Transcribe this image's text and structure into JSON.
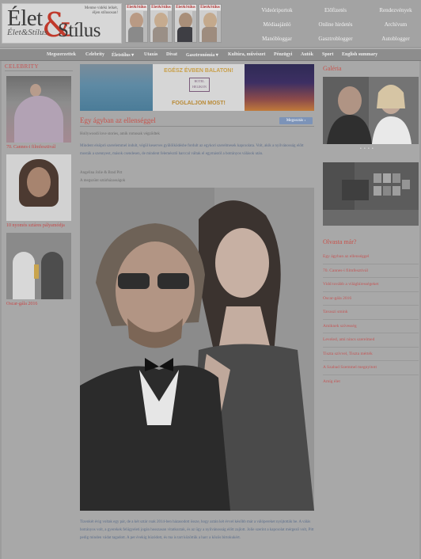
{
  "header": {
    "logo": {
      "word1": "Élet",
      "ampersand": "&",
      "word2": "Stílus",
      "script": "Élet&Stílus",
      "slogan": "Mentse vidéki lelkét, éljen stílusosan!"
    },
    "magazines": [
      {
        "title": "Élet&Stílus"
      },
      {
        "title": "Élet&Stílus"
      },
      {
        "title": "Élet&Stílus"
      },
      {
        "title": "Élet&Stílus"
      }
    ],
    "links": [
      [
        "Videóriportok",
        "Előfizetés",
        "Rendezvények"
      ],
      [
        "Médiaajánló",
        "Online hirdetés",
        "Archívum"
      ],
      [
        "Manóbloggar",
        "Gasztroblogger",
        "Autoblogger"
      ]
    ]
  },
  "nav": {
    "items": [
      "Megszerzettek",
      "Celebrity",
      "Életstílus ▾",
      "Utazás",
      "Divat",
      "Gasztronómia ▾",
      "Kultúra, művészet",
      "Pénzügyi",
      "Autók",
      "Sport",
      "English summary"
    ]
  },
  "left": {
    "heading": "CELEBRITY",
    "items": [
      {
        "caption": "70. Cannes-i filmfesztivál"
      },
      {
        "caption": "10 nyomós sztáres pályamódja"
      },
      {
        "caption": "Oscar-gála 2016"
      }
    ]
  },
  "banner": {
    "headline": "EGÉSZ ÉVBEN BALATON!",
    "hotel": "HOTEL HELIKON",
    "cta": "FOGLALJON MOST!"
  },
  "article": {
    "title": "Egy ágyban az ellenséggel",
    "share_label": "Megosztás",
    "lead": "Hollywoodi love stories, amik romosak végződtek",
    "intro": "Mindent elsöpró szerelemmel indult, végül keserves gyűlölködésbe fordult az egykori szerelmesek kapcsolata. Volt, akik a nyilvánosság előtt mosták a szennyest, mások csendesen, de mindent felemésztő harccal váltak el egymástól a botrányos válások után.",
    "tags": [
      "Angelina Jolie & Brad Pitt",
      "A megszünt sztárházasságok"
    ],
    "body": "Tizenkét évig voltak egy pár, de a két sztár csak 2014-ben házasodott össze, hogy aztán két évvel később már a válópereket nyújtották be. A válás botrányos volt, a gyerekek felügyeleti jogán hosszasan vitatkoztak, és az ügy a nyilvánosság előtt zajlott. Jolie szerint a kapcsolat mérgező volt, Pitt pedig minden vádat tagadott. A per évekig húzódott, és ma is tart közöttük a harc a közös birtokukért."
  },
  "right": {
    "gallery_heading": "Galéria",
    "dots": "• • • •",
    "more_heading": "Olvasta már?",
    "more_items": [
      "Egy ágyban az ellenséggel",
      "70. Cannes-i filmfesztivál",
      "Vidd tovább a világhírességeket",
      "Oscar-gála 2016",
      "Tavaszi smink",
      "Amiknek szívesség",
      "Leveled, ami nincs szerelmed",
      "Tiszta szívvel, Tiszta mérték",
      "A Szabad Szemmel megnyitott",
      "Amíg élet"
    ]
  },
  "colors": {
    "accent": "#c8524b",
    "link": "#5c6d8a",
    "share": "#7c93b8"
  }
}
